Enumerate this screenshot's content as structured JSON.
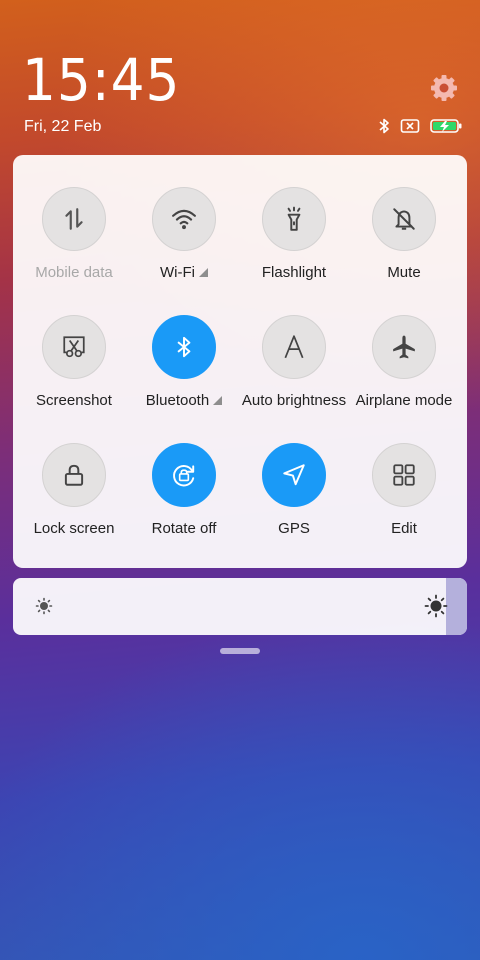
{
  "clock": {
    "time": "15:45",
    "date": "Fri, 22 Feb"
  },
  "status_icons": [
    "bluetooth-icon",
    "no-sim-icon",
    "battery-charging-icon"
  ],
  "colors": {
    "active_tile": "#1a9af7",
    "inactive_tile": "#e4e2e2",
    "brightness_fill": "#b4b0dc"
  },
  "tiles": [
    {
      "label": "Mobile data",
      "icon": "mobile-data-icon",
      "active": false
    },
    {
      "label": "Wi-Fi",
      "icon": "wifi-icon",
      "active": false,
      "expandable": true
    },
    {
      "label": "Flashlight",
      "icon": "flashlight-icon",
      "active": false
    },
    {
      "label": "Mute",
      "icon": "bell-off-icon",
      "active": false
    },
    {
      "label": "Screenshot",
      "icon": "screenshot-icon",
      "active": false
    },
    {
      "label": "Bluetooth",
      "icon": "bluetooth-icon",
      "active": true,
      "expandable": true
    },
    {
      "label": "Auto brightness",
      "icon": "auto-brightness-icon",
      "active": false
    },
    {
      "label": "Airplane mode",
      "icon": "airplane-icon",
      "active": false
    },
    {
      "label": "Lock screen",
      "icon": "lock-icon",
      "active": false
    },
    {
      "label": "Rotate off",
      "icon": "rotation-lock-icon",
      "active": true
    },
    {
      "label": "GPS",
      "icon": "location-arrow-icon",
      "active": true
    },
    {
      "label": "Edit",
      "icon": "grid-icon",
      "active": false
    }
  ],
  "brightness": {
    "level": 0.98
  }
}
